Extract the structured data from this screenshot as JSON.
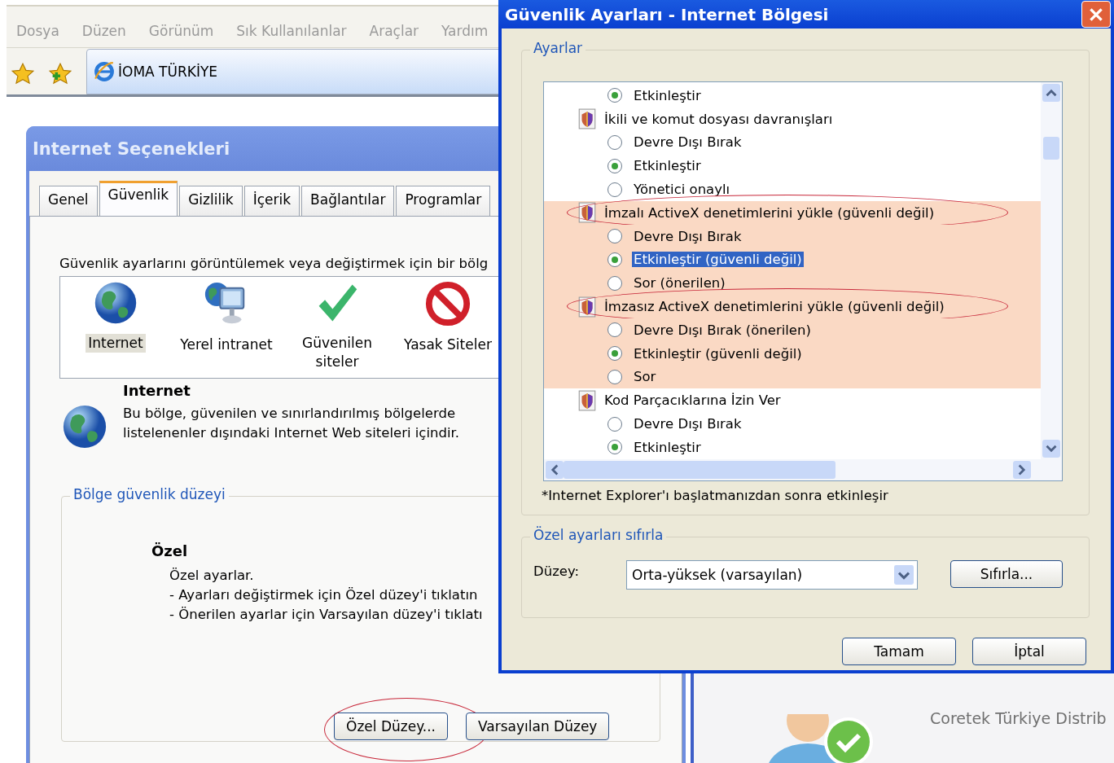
{
  "browser": {
    "menu": [
      "Dosya",
      "Düzen",
      "Görünüm",
      "Sık Kullanılanlar",
      "Araçlar",
      "Yardım"
    ],
    "tab_title": "İOMA TÜRKİYE",
    "page_text": "Coretek Türkiye Distrib"
  },
  "options_dialog": {
    "title": "Internet Seçenekleri",
    "tabs": [
      {
        "label": "Genel",
        "selected": false
      },
      {
        "label": "Güvenlik",
        "selected": true
      },
      {
        "label": "Gizlilik",
        "selected": false
      },
      {
        "label": "İçerik",
        "selected": false
      },
      {
        "label": "Bağlantılar",
        "selected": false
      },
      {
        "label": "Programlar",
        "selected": false
      }
    ],
    "instruction": "Güvenlik ayarlarını görüntülemek veya değiştirmek için bir bölg",
    "zones": [
      {
        "label": "Internet",
        "kind": "globe",
        "selected": true
      },
      {
        "label": "Yerel intranet",
        "kind": "intranet",
        "selected": false
      },
      {
        "label": "Güvenilen siteler",
        "kind": "trusted",
        "selected": false
      },
      {
        "label": "Yasak Siteler",
        "kind": "restricted",
        "selected": false
      }
    ],
    "zone_title": "Internet",
    "zone_description": "Bu bölge, güvenilen ve sınırlandırılmış bölgelerde listelenenler dışındaki Internet Web siteleri içindir.",
    "level_group": "Bölge güvenlik düzeyi",
    "level_name": "Özel",
    "level_lines": [
      "Özel ayarlar.",
      "- Ayarları değiştirmek için Özel düzey'i tıklatın",
      "- Önerilen ayarlar için Varsayılan düzey'i tıklatı"
    ],
    "buttons": [
      {
        "label": "Özel Düzey...",
        "circled": true
      },
      {
        "label": "Varsayılan Düzey",
        "circled": false
      }
    ]
  },
  "settings_dialog": {
    "title": "Güvenlik Ayarları - Internet Bölgesi",
    "group": "Ayarlar",
    "items": [
      {
        "kind": "radio",
        "label": "Etkinleştir",
        "checked": true,
        "highlighted": false,
        "selected": false,
        "circled": false
      },
      {
        "kind": "group",
        "label": "İkili ve komut dosyası davranışları",
        "highlighted": false,
        "circled": false
      },
      {
        "kind": "radio",
        "label": "Devre Dışı Bırak",
        "checked": false,
        "highlighted": false,
        "selected": false,
        "circled": false
      },
      {
        "kind": "radio",
        "label": "Etkinleştir",
        "checked": true,
        "highlighted": false,
        "selected": false,
        "circled": false
      },
      {
        "kind": "radio",
        "label": "Yönetici onaylı",
        "checked": false,
        "highlighted": false,
        "selected": false,
        "circled": false
      },
      {
        "kind": "group",
        "label": "İmzalı ActiveX denetimlerini yükle (güvenli değil)",
        "highlighted": true,
        "circled": true
      },
      {
        "kind": "radio",
        "label": "Devre Dışı Bırak",
        "checked": false,
        "highlighted": true,
        "selected": false,
        "circled": false
      },
      {
        "kind": "radio",
        "label": "Etkinleştir (güvenli değil)",
        "checked": true,
        "highlighted": true,
        "selected": true,
        "circled": false
      },
      {
        "kind": "radio",
        "label": "Sor (önerilen)",
        "checked": false,
        "highlighted": true,
        "selected": false,
        "circled": false
      },
      {
        "kind": "group",
        "label": "İmzasız ActiveX denetimlerini yükle (güvenli değil)",
        "highlighted": true,
        "circled": true
      },
      {
        "kind": "radio",
        "label": "Devre Dışı Bırak (önerilen)",
        "checked": false,
        "highlighted": true,
        "selected": false,
        "circled": false
      },
      {
        "kind": "radio",
        "label": "Etkinleştir (güvenli değil)",
        "checked": true,
        "highlighted": true,
        "selected": false,
        "circled": false
      },
      {
        "kind": "radio",
        "label": "Sor",
        "checked": false,
        "highlighted": true,
        "selected": false,
        "circled": false
      },
      {
        "kind": "group",
        "label": "Kod Parçacıklarına İzin Ver",
        "highlighted": false,
        "circled": false
      },
      {
        "kind": "radio",
        "label": "Devre Dışı Bırak",
        "checked": false,
        "highlighted": false,
        "selected": false,
        "circled": false
      },
      {
        "kind": "radio",
        "label": "Etkinleştir",
        "checked": true,
        "highlighted": false,
        "selected": false,
        "circled": false
      }
    ],
    "note": "*Internet Explorer'ı başlatmanızdan sonra etkinleşir",
    "reset_group": "Özel ayarları sıfırla",
    "level_label": "Düzey:",
    "level_value": "Orta-yüksek (varsayılan)",
    "reset_button": "Sıfırla...",
    "buttons": [
      "Tamam",
      "İptal"
    ]
  }
}
